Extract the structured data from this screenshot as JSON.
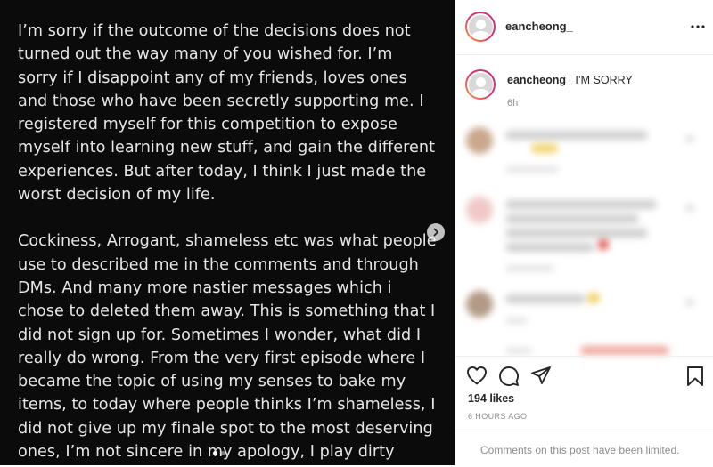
{
  "post": {
    "paragraph1": "I’m sorry if the outcome of the decisions does not turned out the way many of you wished for. I’m sorry if I disappoint any of my friends, loves ones and those who have been secretly supporting me.  I registered myself for this competition to expose myself into learning new stuff, and gain the different experiences. But after today, I think I just made the worst decision of my life.",
    "paragraph2": "Cockiness, Arrogant, shameless etc was what people use to described me in the comments and through DMs. And many more nastier messages which i chose to deleted them away. This is something that I did not sign up for. Sometimes I wonder, what did I really do wrong. From the very first episode where I became the topic of using my senses to bake my items, to today where people thinks I’m shameless, I did not give up my finale spot to the most deserving ones, I’m not sincere in my apology, I play dirty"
  },
  "header": {
    "username": "eancheong_",
    "more_icon": "more-horizontal-icon"
  },
  "caption": {
    "username": "eancheong_",
    "text": "I’M SORRY",
    "time": "6h"
  },
  "likes": "194 likes",
  "time_ago": "6 HOURS AGO",
  "comments_notice": "Comments on this post have been limited.",
  "icons": [
    "heart-icon",
    "comment-icon",
    "share-icon",
    "bookmark-icon",
    "chevron-right-icon"
  ],
  "colors": {
    "text_dark": "#262626",
    "muted": "#8e8e8e",
    "border": "#efefef",
    "image_bg": "#0b0b0b"
  }
}
